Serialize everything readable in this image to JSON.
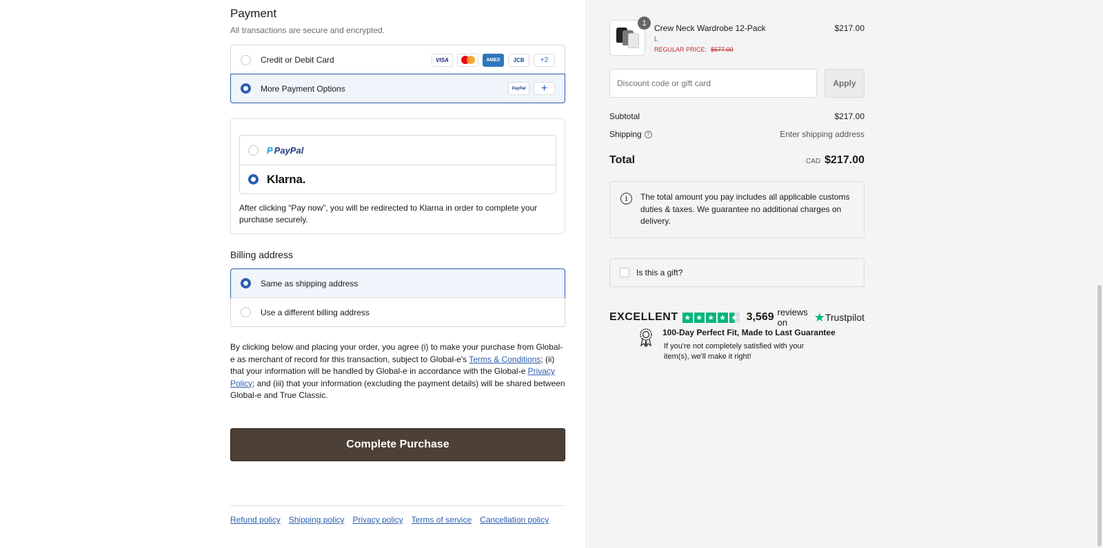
{
  "payment": {
    "title": "Payment",
    "subtitle": "All transactions are secure and encrypted.",
    "options": [
      {
        "label": "Credit or Debit Card",
        "selected": false
      },
      {
        "label": "More Payment Options",
        "selected": true
      }
    ],
    "card_brands": [
      "VISA",
      "AMEX",
      "JCB",
      "+2"
    ],
    "more_options_brand": "PayPal",
    "plus_symbol": "+",
    "wallets": {
      "paypal": {
        "label": "PayPal",
        "selected": false
      },
      "klarna": {
        "label": "Klarna.",
        "selected": true
      }
    },
    "redirect_note": "After clicking “Pay now”, you will be redirected to Klarna in order to complete your purchase securely."
  },
  "billing": {
    "title": "Billing address",
    "options": [
      {
        "label": "Same as shipping address",
        "selected": true
      },
      {
        "label": "Use a different billing address",
        "selected": false
      }
    ]
  },
  "legal": {
    "part1": "By clicking below and placing your order, you agree (i) to make your purchase from Global-e as merchant of record for this transaction, subject to Global-e's ",
    "terms_link": "Terms & Conditions",
    "part2": "; (ii) that your information will be handled by Global-e in accordance with the Global-e ",
    "privacy_link": "Privacy Policy",
    "part3": "; and (iii) that your information (excluding the payment details) will be shared between Global-e and True Classic."
  },
  "cta": {
    "label": "Complete Purchase"
  },
  "footer": {
    "links": [
      "Refund policy",
      "Shipping policy",
      "Privacy policy",
      "Terms of service",
      "Cancellation policy"
    ]
  },
  "cart": {
    "item": {
      "quantity": "1",
      "name": "Crew Neck Wardrobe 12-Pack",
      "size": "L",
      "regular_label": "REGULAR PRICE:",
      "regular_price": "$577.00",
      "price": "$217.00"
    },
    "discount_placeholder": "Discount code or gift card",
    "apply_label": "Apply",
    "subtotal_label": "Subtotal",
    "subtotal_value": "$217.00",
    "shipping_label": "Shipping",
    "shipping_value": "Enter shipping address",
    "total_label": "Total",
    "currency": "CAD",
    "total_value": "$217.00",
    "duties_note": "The total amount you pay includes all applicable customs duties & taxes. We guarantee no additional charges on delivery.",
    "gift_label": "Is this a gift?"
  },
  "trustpilot": {
    "rating_word": "EXCELLENT",
    "rating_stars": 4.5,
    "review_count": "3,569",
    "reviews_on": "reviews on",
    "brand": "Trustpilot",
    "star_color": "#00b67a"
  },
  "guarantee": {
    "title": "100-Day Perfect Fit, Made to Last Guarantee",
    "text": "If you're not completely satisfied with your item(s), we'll make it right!"
  },
  "colors": {
    "accent": "#2a5db0",
    "cta_bg": "#4d4037",
    "sale_red": "#c02b2b"
  }
}
